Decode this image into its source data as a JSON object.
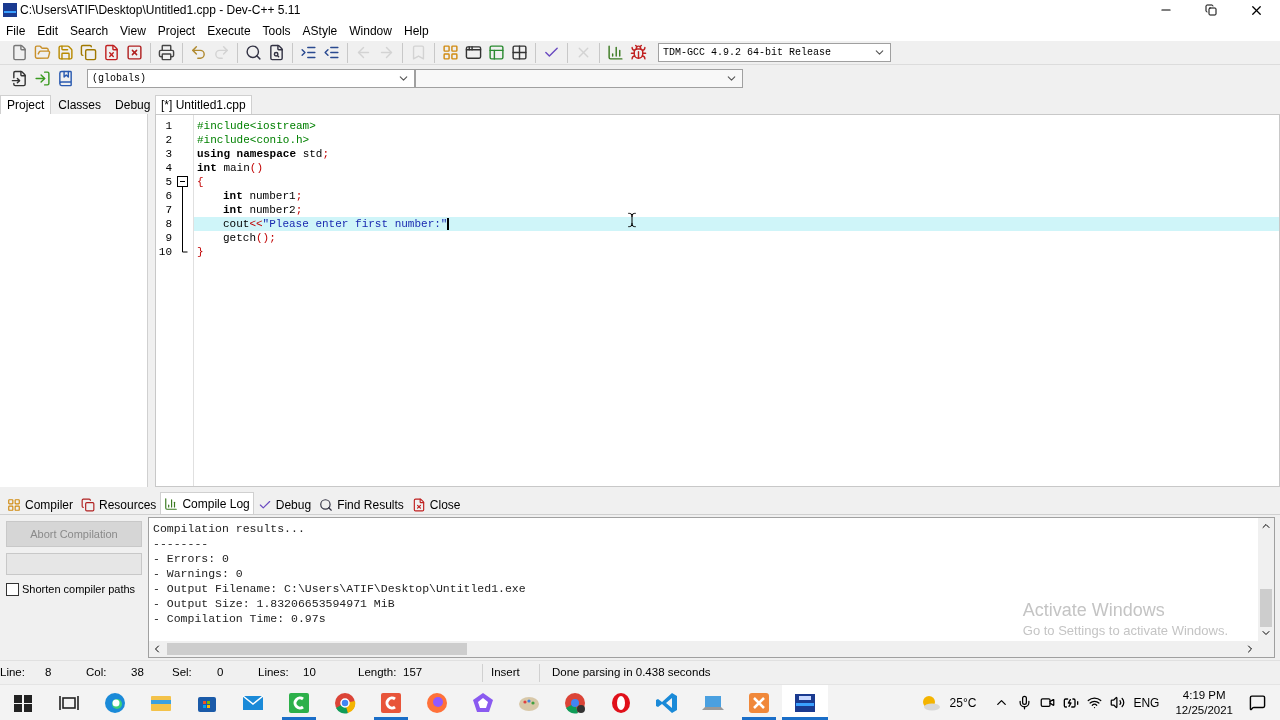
{
  "window": {
    "title": "C:\\Users\\ATIF\\Desktop\\Untitled1.cpp - Dev-C++ 5.11"
  },
  "menu": [
    "File",
    "Edit",
    "Search",
    "View",
    "Project",
    "Execute",
    "Tools",
    "AStyle",
    "Window",
    "Help"
  ],
  "toolbar": [
    {
      "kind": "new",
      "disabled": false
    },
    {
      "kind": "open",
      "disabled": false
    },
    {
      "kind": "save",
      "disabled": false
    },
    {
      "kind": "save-all",
      "disabled": false
    },
    {
      "kind": "close",
      "disabled": false
    },
    {
      "kind": "close-all",
      "disabled": false
    },
    {
      "kind": "separator"
    },
    {
      "kind": "print",
      "disabled": false
    },
    {
      "kind": "separator"
    },
    {
      "kind": "undo",
      "disabled": false
    },
    {
      "kind": "redo",
      "disabled": true
    },
    {
      "kind": "separator"
    },
    {
      "kind": "find",
      "disabled": false
    },
    {
      "kind": "replace",
      "disabled": false
    },
    {
      "kind": "separator"
    },
    {
      "kind": "indent",
      "disabled": false
    },
    {
      "kind": "unindent",
      "disabled": false
    },
    {
      "kind": "separator"
    },
    {
      "kind": "back",
      "disabled": true
    },
    {
      "kind": "forward",
      "disabled": true
    },
    {
      "kind": "separator"
    },
    {
      "kind": "bookmark",
      "disabled": true
    },
    {
      "kind": "separator"
    },
    {
      "kind": "grid",
      "disabled": false
    },
    {
      "kind": "window",
      "disabled": false
    },
    {
      "kind": "panels",
      "disabled": false
    },
    {
      "kind": "grid2",
      "disabled": false
    },
    {
      "kind": "separator"
    },
    {
      "kind": "check",
      "disabled": false
    },
    {
      "kind": "separator"
    },
    {
      "kind": "stop",
      "disabled": true
    },
    {
      "kind": "separator"
    },
    {
      "kind": "chart",
      "disabled": false
    },
    {
      "kind": "profile",
      "disabled": false
    }
  ],
  "compiler_select": {
    "value": "TDM-GCC 4.9.2 64-bit Release"
  },
  "toolbar2": [
    {
      "kind": "compile-file",
      "disabled": false
    },
    {
      "kind": "goto",
      "disabled": false
    },
    {
      "kind": "bookmarks",
      "disabled": false
    }
  ],
  "scope_select": {
    "value": "(globals)"
  },
  "side_tabs": [
    {
      "label": "Project",
      "selected": true
    },
    {
      "label": "Classes",
      "selected": false
    },
    {
      "label": "Debug",
      "selected": false
    }
  ],
  "editor_tabs": [
    {
      "label": "[*] Untitled1.cpp",
      "selected": true
    }
  ],
  "code": [
    {
      "number": "1",
      "indented": false,
      "current": false,
      "fold_start": false,
      "in_fold": false,
      "fold_end": false,
      "tokens": [
        {
          "text": "#include<iostream>",
          "kind": "preprocessor"
        }
      ]
    },
    {
      "number": "2",
      "indented": false,
      "current": false,
      "fold_start": false,
      "in_fold": false,
      "fold_end": false,
      "tokens": [
        {
          "text": "#include<conio.h>",
          "kind": "preprocessor"
        }
      ]
    },
    {
      "number": "3",
      "indented": false,
      "current": false,
      "fold_start": false,
      "in_fold": false,
      "fold_end": false,
      "tokens": [
        {
          "text": "using namespace",
          "kind": "keyword"
        },
        {
          "text": " std",
          "kind": "plain"
        },
        {
          "text": ";",
          "kind": "symbol"
        }
      ]
    },
    {
      "number": "4",
      "indented": false,
      "current": false,
      "fold_start": false,
      "in_fold": false,
      "fold_end": false,
      "tokens": [
        {
          "text": "int",
          "kind": "keyword"
        },
        {
          "text": " main",
          "kind": "plain"
        },
        {
          "text": "()",
          "kind": "symbol"
        }
      ]
    },
    {
      "number": "5",
      "indented": false,
      "current": false,
      "fold_start": true,
      "in_fold": false,
      "fold_end": false,
      "tokens": [
        {
          "text": "{",
          "kind": "symbol"
        }
      ]
    },
    {
      "number": "6",
      "indented": true,
      "current": false,
      "fold_start": false,
      "in_fold": true,
      "fold_end": false,
      "tokens": [
        {
          "text": "int",
          "kind": "keyword"
        },
        {
          "text": " number1",
          "kind": "plain"
        },
        {
          "text": ";",
          "kind": "symbol"
        }
      ]
    },
    {
      "number": "7",
      "indented": true,
      "current": false,
      "fold_start": false,
      "in_fold": true,
      "fold_end": false,
      "tokens": [
        {
          "text": "int",
          "kind": "keyword"
        },
        {
          "text": " number2",
          "kind": "plain"
        },
        {
          "text": ";",
          "kind": "symbol"
        }
      ]
    },
    {
      "number": "8",
      "indented": true,
      "current": true,
      "fold_start": false,
      "in_fold": true,
      "fold_end": false,
      "tokens": [
        {
          "text": "cout",
          "kind": "plain"
        },
        {
          "text": "<<",
          "kind": "symbol"
        },
        {
          "text": "\"Please enter first number:\"",
          "kind": "string"
        }
      ]
    },
    {
      "number": "9",
      "indented": true,
      "current": false,
      "fold_start": false,
      "in_fold": true,
      "fold_end": false,
      "tokens": [
        {
          "text": "getch",
          "kind": "plain"
        },
        {
          "text": "();",
          "kind": "symbol"
        }
      ]
    },
    {
      "number": "10",
      "indented": false,
      "current": false,
      "fold_start": false,
      "in_fold": false,
      "fold_end": true,
      "tokens": [
        {
          "text": "}",
          "kind": "symbol"
        }
      ]
    }
  ],
  "bottom_tabs": [
    {
      "label": "Compiler",
      "kind": "grid",
      "selected": false
    },
    {
      "label": "Resources",
      "kind": "copy",
      "selected": false
    },
    {
      "label": "Compile Log",
      "kind": "chart",
      "selected": true
    },
    {
      "label": "Debug",
      "kind": "check",
      "selected": false
    },
    {
      "label": "Find Results",
      "kind": "find",
      "selected": false
    },
    {
      "label": "Close",
      "kind": "close",
      "selected": false
    }
  ],
  "abort_button": {
    "label": "Abort Compilation",
    "disabled": true
  },
  "progress": {
    "level": 0
  },
  "shorten_paths": {
    "label": "Shorten compiler paths",
    "checked": false
  },
  "log": [
    "Compilation results...",
    "--------",
    "- Errors: 0",
    "- Warnings: 0",
    "- Output Filename: C:\\Users\\ATIF\\Desktop\\Untitled1.exe",
    "- Output Size: 1.83206653594971 MiB",
    "- Compilation Time: 0.97s"
  ],
  "activation_notice": {
    "title": "Activate Windows",
    "message": "Go to Settings to activate Windows."
  },
  "status_bar": [
    {
      "label": "Line:",
      "value": "8"
    },
    {
      "label": "Col:",
      "value": "38"
    },
    {
      "label": "Sel:",
      "value": "0"
    },
    {
      "label": "Lines:",
      "value": "10"
    },
    {
      "label": "Length:",
      "value": "157"
    }
  ],
  "status_mode": "Insert",
  "status_message": "Done parsing in 0.438 seconds",
  "taskbar": [
    {
      "kind": "start",
      "running": false,
      "selected": false
    },
    {
      "kind": "taskview",
      "running": false,
      "selected": false
    },
    {
      "kind": "edge",
      "running": false,
      "selected": false
    },
    {
      "kind": "folder",
      "running": false,
      "selected": false
    },
    {
      "kind": "store",
      "running": false,
      "selected": false
    },
    {
      "kind": "mail",
      "running": false,
      "selected": false
    },
    {
      "kind": "green-c",
      "running": true,
      "selected": false
    },
    {
      "kind": "chrome",
      "running": false,
      "selected": false
    },
    {
      "kind": "red-c",
      "running": true,
      "selected": false
    },
    {
      "kind": "firefox",
      "running": false,
      "selected": false
    },
    {
      "kind": "pentagon",
      "running": false,
      "selected": false
    },
    {
      "kind": "palette",
      "running": false,
      "selected": false
    },
    {
      "kind": "chrome2",
      "running": false,
      "selected": false
    },
    {
      "kind": "opera",
      "running": false,
      "selected": false
    },
    {
      "kind": "vscode",
      "running": false,
      "selected": false
    },
    {
      "kind": "laptop",
      "running": false,
      "selected": false
    },
    {
      "kind": "xampp",
      "running": true,
      "selected": false
    },
    {
      "kind": "dev",
      "running": true,
      "selected": true
    }
  ],
  "tray": {
    "temperature": "25°C",
    "language": "ENG",
    "time": "4:19 PM",
    "date": "12/25/2021"
  }
}
